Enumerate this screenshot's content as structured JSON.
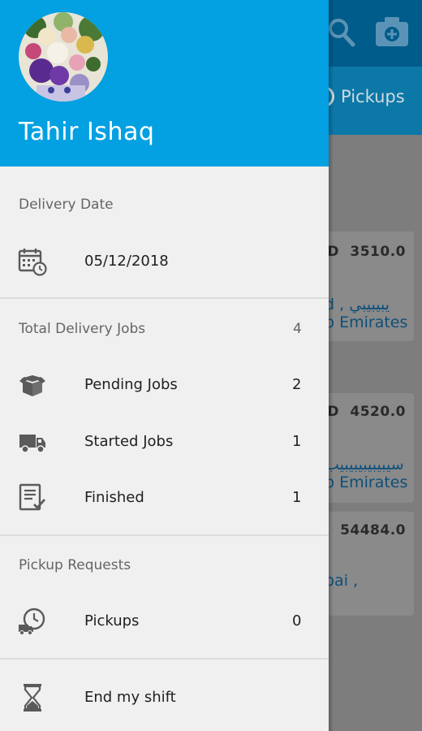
{
  "drawer": {
    "user_name": "Tahir Ishaq",
    "delivery_date_label": "Delivery Date",
    "delivery_date_value": "05/12/2018",
    "total_jobs_label": "Total Delivery Jobs",
    "total_jobs_count": "4",
    "items": [
      {
        "label": "Pending Jobs",
        "count": "2",
        "icon": "open-box-icon"
      },
      {
        "label": "Started Jobs",
        "count": "1",
        "icon": "delivery-truck-icon"
      },
      {
        "label": "Finished",
        "count": "1",
        "icon": "checklist-icon"
      }
    ],
    "pickup_section_label": "Pickup Requests",
    "pickups": {
      "label": "Pickups",
      "count": "0",
      "icon": "pickup-clock-truck-icon"
    },
    "end_shift_label": "End my shift",
    "end_shift_icon": "hourglass-icon"
  },
  "background": {
    "toolbar_icons": [
      "search-icon",
      "add-photo-icon"
    ],
    "tab_pickups_label": "Pickups",
    "cards": [
      {
        "amount_prefix": "D",
        "amount": "3510.0",
        "line1": "d , يبيبيبي",
        "line2": "b Emirates"
      },
      {
        "amount_prefix": "D",
        "amount": "4520.0",
        "line1": "سيبيبيبيبيبيب",
        "line2": "b Emirates"
      },
      {
        "amount_prefix": "",
        "amount": "54484.0",
        "line1": "pai ,",
        "line2": ""
      }
    ]
  },
  "colors": {
    "drawer_header": "#03a0e2",
    "drawer_body": "#f0f0f0",
    "toolbar_dimmed": "#005c8a",
    "tabs_dimmed": "#0b78a8"
  }
}
